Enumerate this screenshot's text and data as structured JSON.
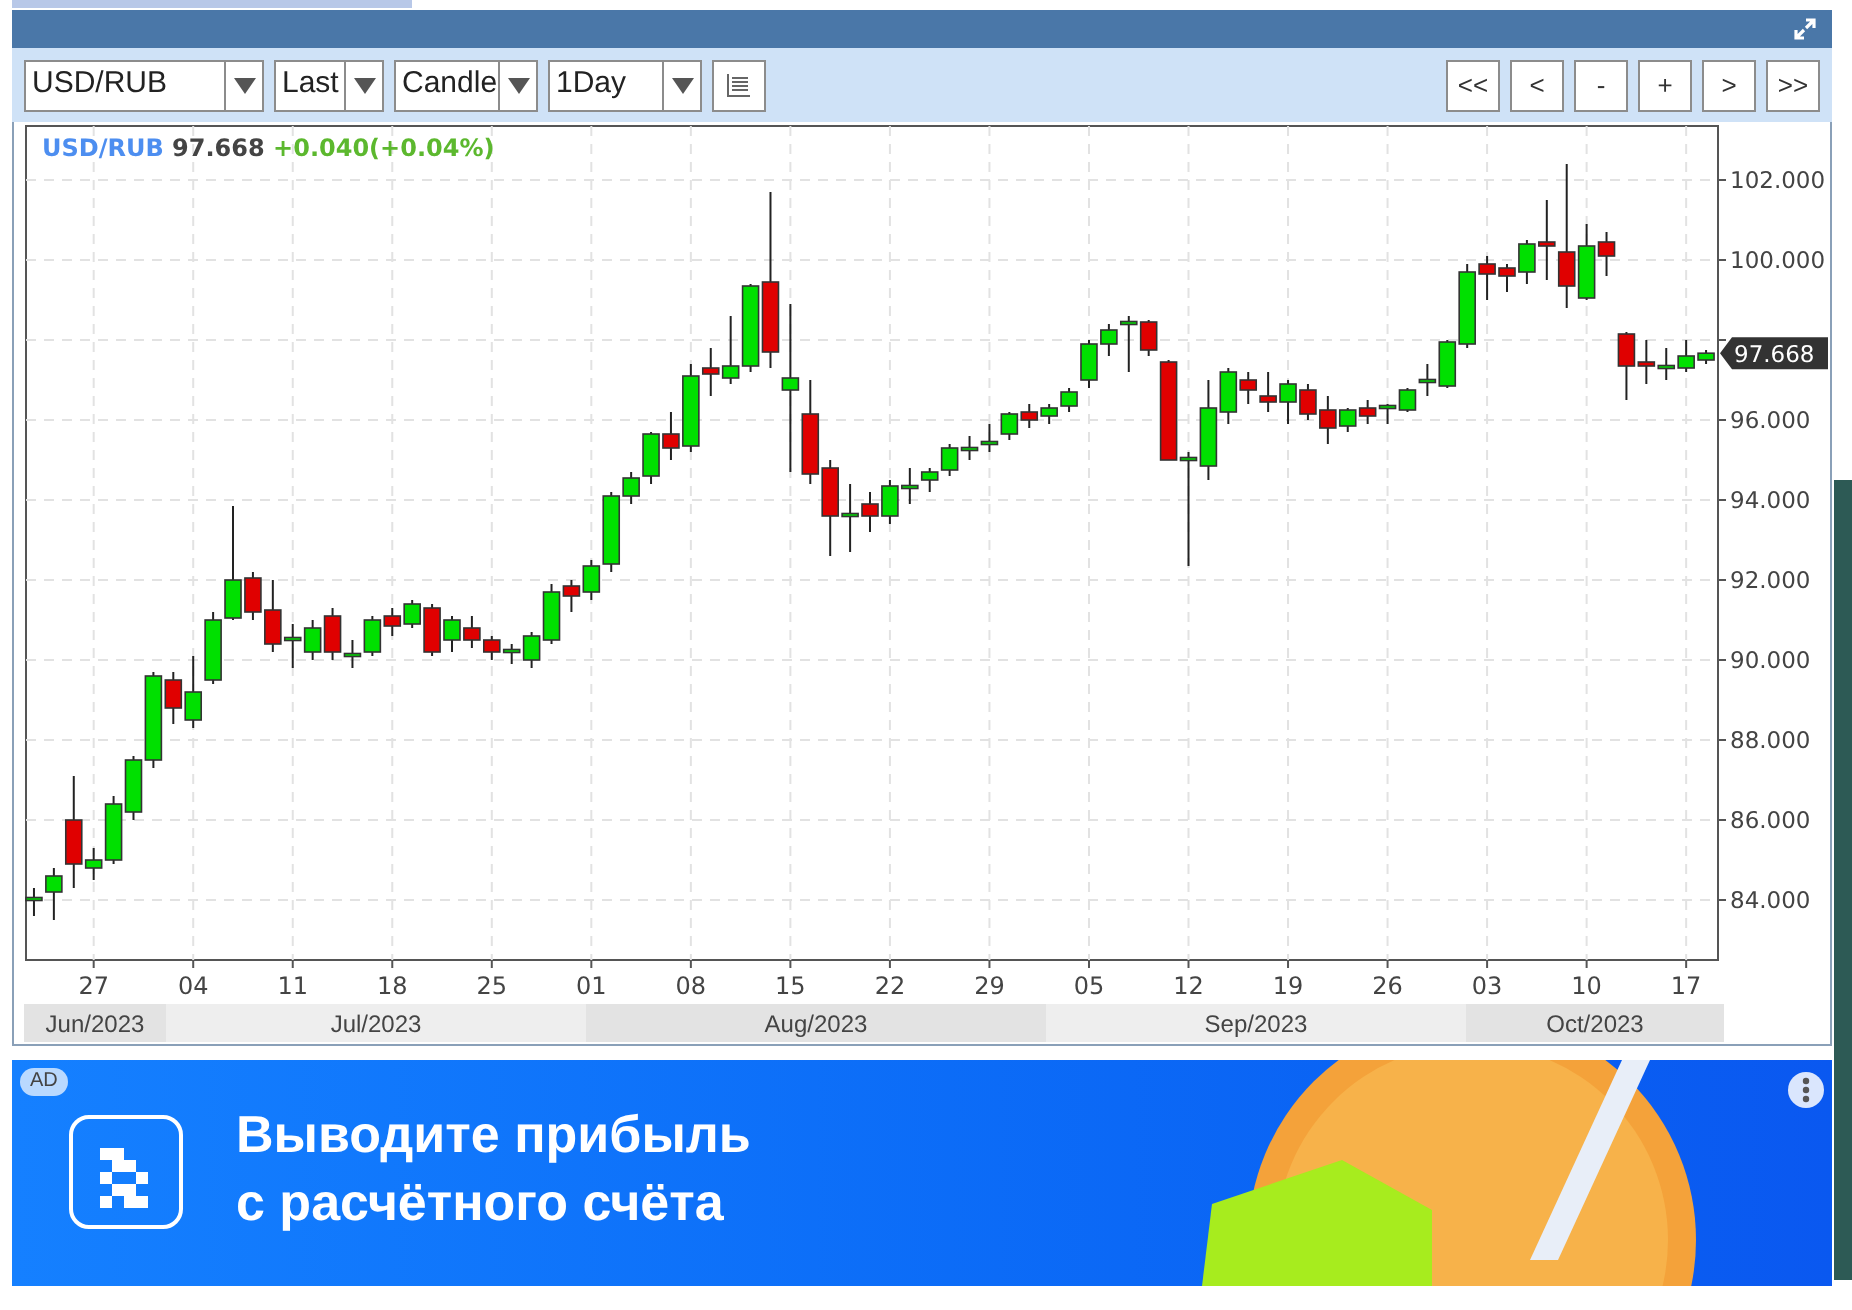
{
  "toolbar": {
    "dropdowns": [
      {
        "value": "USD/RUB"
      },
      {
        "value": "Last"
      },
      {
        "value": "Candle"
      },
      {
        "value": "1Day"
      }
    ],
    "nav_buttons": [
      "<<",
      "<",
      "-",
      "+",
      ">",
      ">>"
    ]
  },
  "chart": {
    "legend": {
      "symbol": "USD/RUB",
      "price": "97.668",
      "change": "+0.040(+0.04%)"
    },
    "price_tag": "97.668",
    "months": [
      "Jun/2023",
      "Jul/2023",
      "Aug/2023",
      "Sep/2023",
      "Oct/2023"
    ],
    "chart_data": {
      "type": "candlestick",
      "ylim": [
        82.5,
        103.35
      ],
      "grid": true,
      "yticks": [
        {
          "value": 84,
          "label": "84.000"
        },
        {
          "value": 86,
          "label": "86.000"
        },
        {
          "value": 88,
          "label": "88.000"
        },
        {
          "value": 90,
          "label": "90.000"
        },
        {
          "value": 92,
          "label": "92.000"
        },
        {
          "value": 94,
          "label": "94.000"
        },
        {
          "value": 96,
          "label": "96.000"
        },
        {
          "value": 100,
          "label": "100.000"
        },
        {
          "value": 102,
          "label": "102.000"
        }
      ],
      "categories": [
        null,
        null,
        null,
        "27",
        null,
        null,
        null,
        null,
        "04",
        null,
        null,
        null,
        null,
        "11",
        null,
        null,
        null,
        null,
        "18",
        null,
        null,
        null,
        null,
        "25",
        null,
        null,
        null,
        null,
        "01",
        null,
        null,
        null,
        null,
        "08",
        null,
        null,
        null,
        null,
        "15",
        null,
        null,
        null,
        null,
        "22",
        null,
        null,
        null,
        null,
        "29",
        null,
        null,
        null,
        null,
        "05",
        null,
        null,
        null,
        null,
        "12",
        null,
        null,
        null,
        null,
        "19",
        null,
        null,
        null,
        null,
        "26",
        null,
        null,
        null,
        null,
        "03",
        null,
        null,
        null,
        null,
        "10",
        null,
        null,
        null,
        null,
        "17",
        null
      ],
      "ohlc": [
        [
          84.0,
          84.3,
          83.6,
          84.05
        ],
        [
          84.2,
          84.8,
          83.5,
          84.6
        ],
        [
          86.0,
          87.1,
          84.3,
          84.9
        ],
        [
          84.8,
          85.3,
          84.5,
          85.0
        ],
        [
          85.0,
          86.6,
          84.9,
          86.4
        ],
        [
          86.2,
          87.6,
          86.0,
          87.5
        ],
        [
          87.5,
          89.7,
          87.3,
          89.6
        ],
        [
          89.5,
          89.7,
          88.4,
          88.8
        ],
        [
          88.5,
          90.1,
          88.3,
          89.2
        ],
        [
          89.5,
          91.2,
          89.4,
          91.0
        ],
        [
          91.05,
          93.85,
          91.0,
          92.0
        ],
        [
          92.05,
          92.2,
          91.0,
          91.2
        ],
        [
          91.25,
          92.0,
          90.2,
          90.4
        ],
        [
          90.5,
          90.9,
          89.8,
          90.55
        ],
        [
          90.2,
          91.0,
          90.0,
          90.8
        ],
        [
          91.1,
          91.3,
          90.0,
          90.2
        ],
        [
          90.1,
          90.5,
          89.8,
          90.15
        ],
        [
          90.2,
          91.1,
          90.1,
          91.0
        ],
        [
          91.1,
          91.3,
          90.6,
          90.85
        ],
        [
          90.9,
          91.5,
          90.8,
          91.4
        ],
        [
          91.3,
          91.4,
          90.1,
          90.2
        ],
        [
          90.5,
          91.1,
          90.2,
          91.0
        ],
        [
          90.8,
          91.1,
          90.3,
          90.5
        ],
        [
          90.5,
          90.6,
          90.0,
          90.2
        ],
        [
          90.2,
          90.4,
          89.9,
          90.25
        ],
        [
          90.0,
          90.7,
          89.8,
          90.6
        ],
        [
          90.5,
          91.9,
          90.4,
          91.7
        ],
        [
          91.85,
          92.0,
          91.2,
          91.6
        ],
        [
          91.7,
          92.5,
          91.5,
          92.35
        ],
        [
          92.4,
          94.2,
          92.2,
          94.1
        ],
        [
          94.1,
          94.7,
          93.9,
          94.55
        ],
        [
          94.6,
          95.7,
          94.4,
          95.65
        ],
        [
          95.65,
          96.2,
          95.0,
          95.3
        ],
        [
          95.35,
          97.4,
          95.2,
          97.1
        ],
        [
          97.3,
          97.8,
          96.6,
          97.15
        ],
        [
          97.05,
          98.6,
          96.9,
          97.35
        ],
        [
          97.35,
          99.4,
          97.2,
          99.35
        ],
        [
          99.45,
          101.7,
          97.3,
          97.7
        ],
        [
          96.75,
          98.9,
          94.7,
          97.05
        ],
        [
          96.15,
          97.0,
          94.4,
          94.65
        ],
        [
          94.8,
          95.0,
          92.6,
          93.6
        ],
        [
          93.6,
          94.4,
          92.7,
          93.65
        ],
        [
          93.9,
          94.2,
          93.2,
          93.6
        ],
        [
          93.6,
          94.5,
          93.4,
          94.35
        ],
        [
          94.3,
          94.8,
          93.9,
          94.35
        ],
        [
          94.5,
          94.8,
          94.2,
          94.7
        ],
        [
          94.75,
          95.4,
          94.6,
          95.3
        ],
        [
          95.25,
          95.6,
          95.0,
          95.3
        ],
        [
          95.4,
          95.9,
          95.2,
          95.45
        ],
        [
          95.65,
          96.2,
          95.5,
          96.15
        ],
        [
          96.2,
          96.4,
          95.8,
          96.0
        ],
        [
          96.1,
          96.4,
          95.9,
          96.3
        ],
        [
          96.35,
          96.8,
          96.2,
          96.7
        ],
        [
          97.0,
          98.0,
          96.8,
          97.9
        ],
        [
          97.9,
          98.4,
          97.6,
          98.25
        ],
        [
          98.4,
          98.6,
          97.2,
          98.45
        ],
        [
          98.45,
          98.5,
          97.6,
          97.75
        ],
        [
          97.45,
          97.5,
          95.0,
          95.0
        ],
        [
          95.0,
          95.2,
          92.35,
          95.05
        ],
        [
          94.85,
          97.0,
          94.5,
          96.3
        ],
        [
          96.2,
          97.3,
          95.9,
          97.2
        ],
        [
          97.0,
          97.2,
          96.4,
          96.75
        ],
        [
          96.6,
          97.2,
          96.2,
          96.45
        ],
        [
          96.45,
          97.0,
          95.9,
          96.9
        ],
        [
          96.75,
          96.9,
          96.0,
          96.15
        ],
        [
          96.25,
          96.6,
          95.4,
          95.8
        ],
        [
          95.85,
          96.3,
          95.7,
          96.25
        ],
        [
          96.3,
          96.5,
          95.9,
          96.1
        ],
        [
          96.3,
          96.4,
          95.9,
          96.35
        ],
        [
          96.25,
          96.8,
          96.2,
          96.75
        ],
        [
          96.95,
          97.4,
          96.6,
          97.0
        ],
        [
          96.85,
          98.0,
          96.8,
          97.95
        ],
        [
          97.9,
          99.9,
          97.8,
          99.7
        ],
        [
          99.9,
          100.1,
          99.0,
          99.65
        ],
        [
          99.8,
          99.9,
          99.2,
          99.6
        ],
        [
          99.7,
          100.5,
          99.4,
          100.4
        ],
        [
          100.45,
          101.5,
          99.5,
          100.35
        ],
        [
          100.2,
          102.4,
          98.8,
          99.35
        ],
        [
          99.05,
          100.9,
          99.0,
          100.35
        ],
        [
          100.45,
          100.7,
          99.6,
          100.1
        ],
        [
          98.15,
          98.2,
          96.5,
          97.35
        ],
        [
          97.45,
          98.0,
          96.9,
          97.35
        ],
        [
          97.3,
          97.8,
          97.0,
          97.35
        ],
        [
          97.3,
          98.0,
          97.2,
          97.6
        ],
        [
          97.5,
          97.75,
          97.4,
          97.67
        ]
      ]
    }
  },
  "ad": {
    "badge": "AD",
    "lines": [
      "Выводите прибыль",
      "с расчётного счёта"
    ]
  }
}
